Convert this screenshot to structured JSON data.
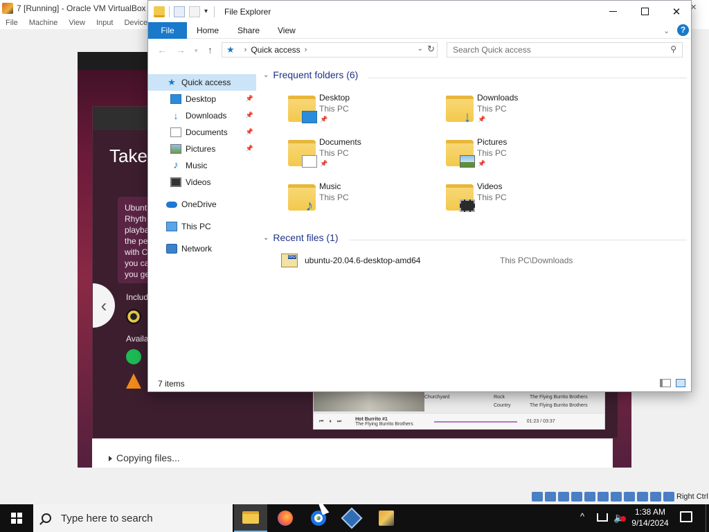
{
  "vbox": {
    "title": "7 [Running] - Oracle VM VirtualBox",
    "menu": [
      "File",
      "Machine",
      "View",
      "Input",
      "Devices"
    ],
    "host_key": "Right Ctrl"
  },
  "guest": {
    "heading": "Take",
    "card_lines": [
      "Ubunt",
      "Rhyth",
      "playba",
      "the pe",
      "with C",
      "you ca",
      "you ge"
    ],
    "included_label": "Includ",
    "available_label": "Availa",
    "music_rows": [
      {
        "title": "Churchyard",
        "genre": "Rock",
        "artist": "The Flying Burrito Brothers"
      },
      {
        "title": "",
        "genre": "Country",
        "artist": "The Flying Burrito Brothers"
      }
    ],
    "now_playing_title": "Hot Burrito #1",
    "now_playing_artist": "The Flying Burrito Brothers",
    "now_playing_time": "01:23 / 03:37",
    "status": "Copying files..."
  },
  "explorer": {
    "title": "File Explorer",
    "ribbon_tabs": {
      "file": "File",
      "home": "Home",
      "share": "Share",
      "view": "View"
    },
    "help_label": "?",
    "address": "Quick access",
    "search_placeholder": "Search Quick access",
    "nav": {
      "quick_access": "Quick access",
      "items": [
        "Desktop",
        "Downloads",
        "Documents",
        "Pictures",
        "Music",
        "Videos"
      ],
      "onedrive": "OneDrive",
      "thispc": "This PC",
      "network": "Network"
    },
    "frequent_header": "Frequent folders (6)",
    "folders": [
      {
        "name": "Desktop",
        "location": "This PC"
      },
      {
        "name": "Downloads",
        "location": "This PC"
      },
      {
        "name": "Documents",
        "location": "This PC"
      },
      {
        "name": "Pictures",
        "location": "This PC"
      },
      {
        "name": "Music",
        "location": "This PC"
      },
      {
        "name": "Videos",
        "location": "This PC"
      }
    ],
    "recent_header": "Recent files (1)",
    "recent_files": [
      {
        "name": "ubuntu-20.04.6-desktop-amd64",
        "path": "This PC\\Downloads",
        "badge": "ISO"
      }
    ],
    "status": "7 items"
  },
  "taskbar": {
    "search_placeholder": "Type here to search",
    "time": "1:38 AM",
    "date": "9/14/2024"
  },
  "colors": {
    "accent": "#1979ca",
    "selection": "#cce4f7",
    "folder": "#f2c94c"
  }
}
